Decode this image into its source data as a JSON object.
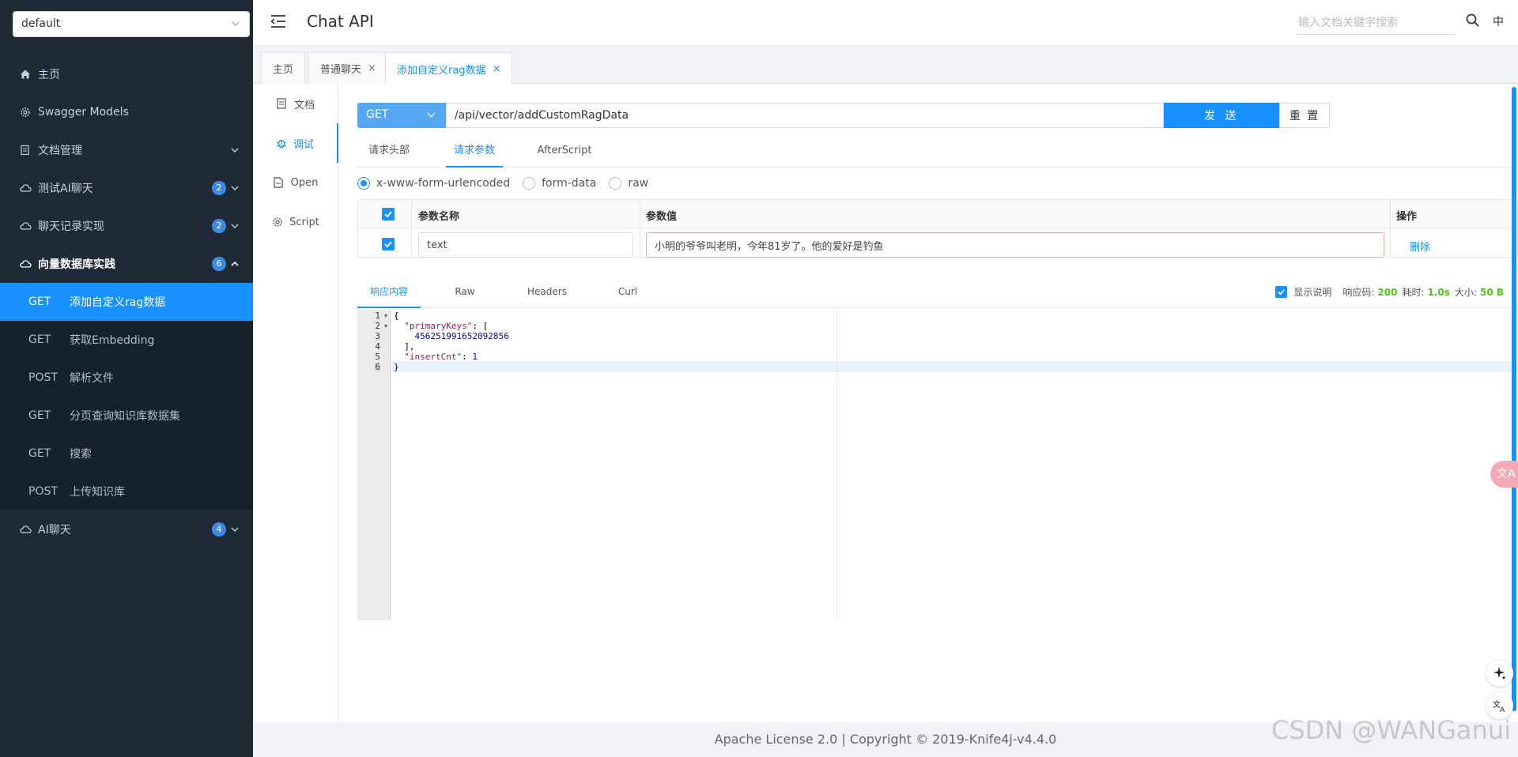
{
  "sidebar": {
    "group_select": "default",
    "items": [
      {
        "label": "主页",
        "icon": "home-icon"
      },
      {
        "label": "Swagger Models",
        "icon": "gear-icon"
      },
      {
        "label": "文档管理",
        "icon": "document-manage-icon"
      },
      {
        "label": "测试AI聊天",
        "icon": "cloud-icon",
        "badge": "2"
      },
      {
        "label": "聊天记录实现",
        "icon": "cloud-icon",
        "badge": "2"
      },
      {
        "label": "向量数据库实践",
        "icon": "cloud-icon",
        "badge": "6"
      },
      {
        "label": "AI聊天",
        "icon": "cloud-icon",
        "badge": "4"
      }
    ],
    "sub_items": [
      {
        "method": "GET",
        "label": "添加自定义rag数据"
      },
      {
        "method": "GET",
        "label": "获取Embedding"
      },
      {
        "method": "POST",
        "label": "解析文件"
      },
      {
        "method": "GET",
        "label": "分页查询知识库数据集"
      },
      {
        "method": "GET",
        "label": "搜索"
      },
      {
        "method": "POST",
        "label": "上传知识库"
      }
    ]
  },
  "header": {
    "title": "Chat API",
    "search_placeholder": "输入文档关键字搜索",
    "lang": "中"
  },
  "page_tabs": [
    {
      "label": "主页"
    },
    {
      "label": "普通聊天",
      "close": "×"
    },
    {
      "label": "添加自定义rag数据",
      "close": "×"
    }
  ],
  "side_tabs": [
    {
      "label": "文档",
      "icon": "document-icon"
    },
    {
      "label": "调试",
      "icon": "bug-icon"
    },
    {
      "label": "Open",
      "icon": "file-icon"
    },
    {
      "label": "Script",
      "icon": "script-icon"
    }
  ],
  "request": {
    "method": "GET",
    "url": "/api/vector/addCustomRagData",
    "send_label": "发 送",
    "reset_label": "重 置",
    "tabs": [
      "请求头部",
      "请求参数",
      "AfterScript"
    ],
    "content_types": [
      "x-www-form-urlencoded",
      "form-data",
      "raw"
    ],
    "table": {
      "headers": [
        "参数名称",
        "参数值",
        "操作"
      ],
      "row": {
        "name": "text",
        "value": "小明的爷爷叫老明，今年81岁了。他的爱好是钓鱼",
        "action": "删除"
      }
    }
  },
  "response": {
    "tabs": [
      "响应内容",
      "Raw",
      "Headers",
      "Curl"
    ],
    "show_desc_label": "显示说明",
    "status_label": "响应码:",
    "status": "200",
    "time_label": "耗时:",
    "time": "1.0s",
    "size_label": "大小:",
    "size": "50 B",
    "line_numbers": [
      "1",
      "2",
      "3",
      "4",
      "5",
      "6"
    ],
    "code": {
      "open_brace": "{",
      "key1": "\"primaryKeys\"",
      "key1_rest": ": [",
      "value1": "456251991652092856",
      "close_arr": "],",
      "key2": "\"insertCnt\"",
      "key2_colon": ": ",
      "value2": "1",
      "close_brace": "}"
    }
  },
  "footer": "Apache License 2.0 | Copyright © 2019-Knife4j-v4.4.0",
  "watermark": "CSDN @WANGanui",
  "colors": {
    "primary": "#1890ff",
    "sidebar_bg": "#1f2a36",
    "success": "#52c41a"
  }
}
